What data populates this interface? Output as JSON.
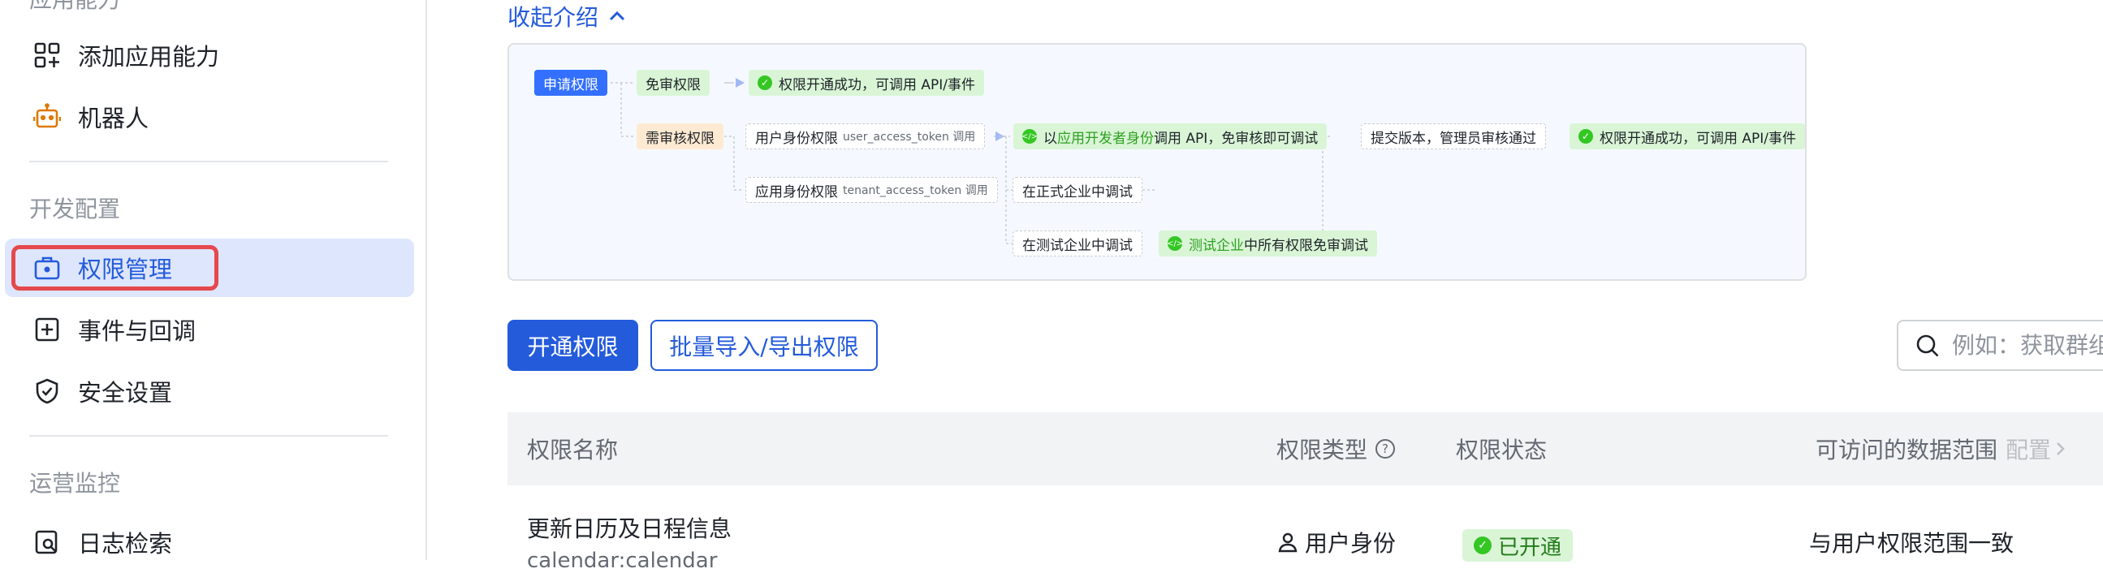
{
  "sidebar": {
    "top_section_cut": "应用能力",
    "items_top": [
      {
        "label": "添加应用能力",
        "icon": "grid-plus-icon"
      },
      {
        "label": "机器人",
        "icon": "robot-icon"
      }
    ],
    "dev_section": "开发配置",
    "items_dev": [
      {
        "label": "权限管理",
        "icon": "briefcase-lock-icon",
        "active": true
      },
      {
        "label": "事件与回调",
        "icon": "plus-square-icon"
      },
      {
        "label": "安全设置",
        "icon": "shield-check-icon"
      }
    ],
    "ops_section": "运营监控",
    "items_ops": [
      {
        "label": "日志检索",
        "icon": "log-search-icon"
      }
    ]
  },
  "intro": {
    "collapse_label": "收起介绍",
    "flow": {
      "apply": "申请权限",
      "free": "免审权限",
      "free_result": "权限开通成功，可调用 API/事件",
      "review": "需审核权限",
      "user_auth": "用户身份权限",
      "user_token": "user_access_token 调用",
      "dev_prefix": "以",
      "dev_green": "应用开发者身份",
      "dev_suffix": "调用 API，免审核即可调试",
      "submit": "提交版本，管理员审核通过",
      "final_result": "权限开通成功，可调用 API/事件",
      "tenant_auth": "应用身份权限",
      "tenant_token": "tenant_access_token 调用",
      "prod_debug": "在正式企业中调试",
      "test_debug": "在测试企业中调试",
      "test_green": "测试企业",
      "test_suffix": "中所有权限免审调试"
    }
  },
  "toolbar": {
    "enable_button": "开通权限",
    "batch_button": "批量导入/导出权限",
    "search_placeholder": "例如：获取群组"
  },
  "table": {
    "headers": {
      "name": "权限名称",
      "type": "权限类型",
      "status": "权限状态",
      "scope": "可访问的数据范围",
      "scope_config": "配置"
    },
    "rows": [
      {
        "name": "更新日历及日程信息",
        "code": "calendar:calendar",
        "type": "用户身份",
        "status": "已开通",
        "scope": "与用户权限范围一致"
      }
    ]
  },
  "colors": {
    "accent": "#245bdb",
    "active_bg": "#dde6fd",
    "highlight": "#e5484d",
    "success": "#34c724"
  }
}
